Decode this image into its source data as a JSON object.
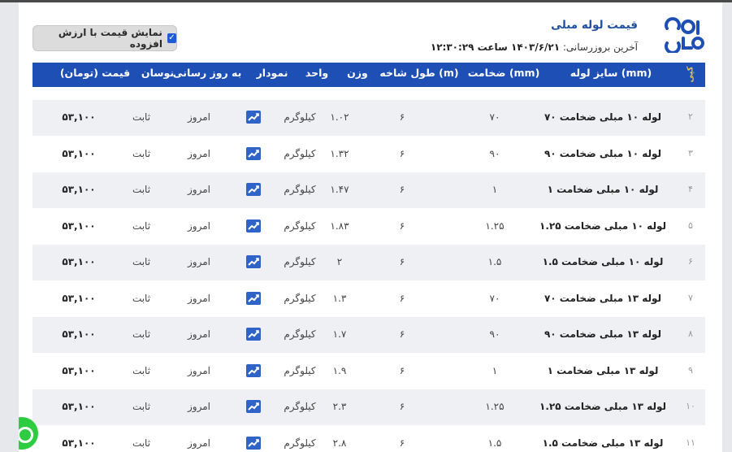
{
  "header": {
    "title": "قیمت لوله مبلی",
    "updated_label": "آخرین بروزرسانی:",
    "updated_value": "۱۴۰۳/۶/۲۱ ساعت ۱۲:۳۰:۲۹",
    "vat_toggle_label": "نمایش قیمت با ارزش افزوده",
    "vat_checked": true,
    "logo_icon": "company-logo-icon",
    "accent": "#1e4fb4"
  },
  "columns": {
    "corner": "کپی",
    "size": "سایز لوله (mm)",
    "thickness": "ضخامت (mm)",
    "length": "طول شاخه (m)",
    "weight": "وزن",
    "unit": "واحد",
    "chart": "نمودار",
    "updated": "به روز رسانی",
    "change": "نوسان",
    "price": "قیمت (تومان)"
  },
  "rows": [
    {
      "n": "۲",
      "name": "لوله ۱۰ مبلی ضخامت ۷۰",
      "thickness": "۷۰",
      "length": "۶",
      "weight": "۱.۰۲",
      "unit": "کیلوگرم",
      "updated": "امروز",
      "change": "ثابت",
      "price": "۵۳,۱۰۰"
    },
    {
      "n": "۳",
      "name": "لوله ۱۰ مبلی ضخامت ۹۰",
      "thickness": "۹۰",
      "length": "۶",
      "weight": "۱.۳۲",
      "unit": "کیلوگرم",
      "updated": "امروز",
      "change": "ثابت",
      "price": "۵۳,۱۰۰"
    },
    {
      "n": "۴",
      "name": "لوله ۱۰ مبلی ضخامت ۱",
      "thickness": "۱",
      "length": "۶",
      "weight": "۱.۴۷",
      "unit": "کیلوگرم",
      "updated": "امروز",
      "change": "ثابت",
      "price": "۵۳,۱۰۰"
    },
    {
      "n": "۵",
      "name": "لوله ۱۰ مبلی ضخامت ۱.۲۵",
      "thickness": "۱.۲۵",
      "length": "۶",
      "weight": "۱.۸۳",
      "unit": "کیلوگرم",
      "updated": "امروز",
      "change": "ثابت",
      "price": "۵۳,۱۰۰"
    },
    {
      "n": "۶",
      "name": "لوله ۱۰ مبلی ضخامت ۱.۵",
      "thickness": "۱.۵",
      "length": "۶",
      "weight": "۲",
      "unit": "کیلوگرم",
      "updated": "امروز",
      "change": "ثابت",
      "price": "۵۳,۱۰۰"
    },
    {
      "n": "۷",
      "name": "لوله ۱۳ مبلی ضخامت ۷۰",
      "thickness": "۷۰",
      "length": "۶",
      "weight": "۱.۳",
      "unit": "کیلوگرم",
      "updated": "امروز",
      "change": "ثابت",
      "price": "۵۳,۱۰۰"
    },
    {
      "n": "۸",
      "name": "لوله ۱۳ مبلی ضخامت ۹۰",
      "thickness": "۹۰",
      "length": "۶",
      "weight": "۱.۷",
      "unit": "کیلوگرم",
      "updated": "امروز",
      "change": "ثابت",
      "price": "۵۳,۱۰۰"
    },
    {
      "n": "۹",
      "name": "لوله ۱۳ مبلی ضخامت ۱",
      "thickness": "۱",
      "length": "۶",
      "weight": "۱.۹",
      "unit": "کیلوگرم",
      "updated": "امروز",
      "change": "ثابت",
      "price": "۵۳,۱۰۰"
    },
    {
      "n": "۱۰",
      "name": "لوله ۱۳ مبلی ضخامت ۱.۲۵",
      "thickness": "۱.۲۵",
      "length": "۶",
      "weight": "۲.۳",
      "unit": "کیلوگرم",
      "updated": "امروز",
      "change": "ثابت",
      "price": "۵۳,۱۰۰"
    },
    {
      "n": "۱۱",
      "name": "لوله ۱۳ مبلی ضخامت ۱.۵",
      "thickness": "۱.۵",
      "length": "۶",
      "weight": "۲.۸",
      "unit": "کیلوگرم",
      "updated": "امروز",
      "change": "ثابت",
      "price": "۵۳,۱۰۰"
    }
  ],
  "icons": {
    "chart": "trend-chart-icon",
    "chat": "chat-bubble-icon"
  }
}
